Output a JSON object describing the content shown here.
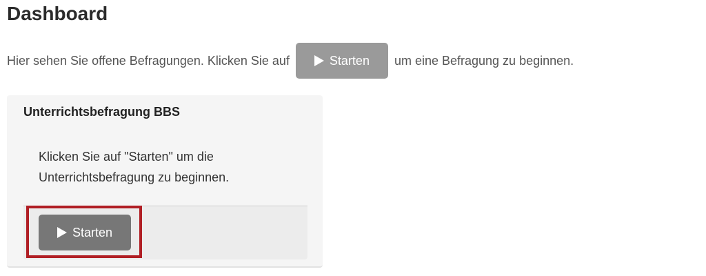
{
  "header": {
    "title": "Dashboard"
  },
  "intro": {
    "text_before": "Hier sehen Sie offene Befragungen. Klicken Sie auf",
    "button_label": "Starten",
    "text_after": "um eine Befragung zu beginnen."
  },
  "survey_card": {
    "title": "Unterrichtsbefragung BBS",
    "description": "Klicken Sie auf \"Starten\" um die Unterrichtsbefragung zu beginnen.",
    "start_button_label": "Starten"
  },
  "icons": {
    "play": "play-icon"
  },
  "colors": {
    "inline_button": "#9a9a9a",
    "start_button": "#777777",
    "highlight": "#b01e24",
    "card_background": "#f5f5f5"
  }
}
